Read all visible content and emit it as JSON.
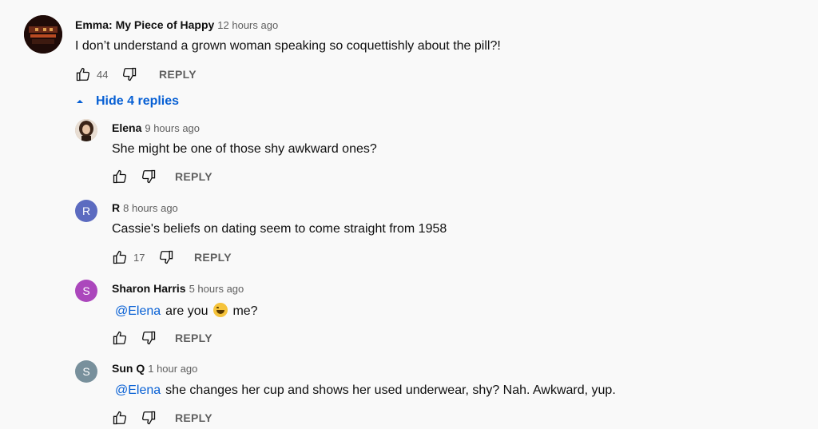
{
  "main_comment": {
    "author": "Emma: My Piece of Happy",
    "time": "12 hours ago",
    "text": "I don’t understand a grown woman speaking so coquettishly about the pill?!",
    "likes": "44",
    "reply_label": "REPLY"
  },
  "hide_replies_label": "Hide 4 replies",
  "replies": [
    {
      "author": "Elena",
      "time": "9 hours ago",
      "mention": "",
      "text": "She might be one of those shy awkward ones?",
      "likes": "",
      "reply_label": "REPLY",
      "avatar_letter": ""
    },
    {
      "author": "R",
      "time": "8 hours ago",
      "mention": "",
      "text": "Cassie's beliefs on dating seem to come straight from 1958",
      "likes": "17",
      "reply_label": "REPLY",
      "avatar_letter": "R",
      "avatar_color": "#5c6bc0"
    },
    {
      "author": "Sharon Harris",
      "time": "5 hours ago",
      "mention": "@Elena",
      "text_before_emoji": "are you",
      "text_after_emoji": "me?",
      "likes": "",
      "reply_label": "REPLY",
      "avatar_letter": "S",
      "avatar_color": "#ab47bc"
    },
    {
      "author": "Sun Q",
      "time": "1 hour ago",
      "mention": "@Elena",
      "text": "she changes her cup and shows her used underwear, shy? Nah. Awkward, yup.",
      "likes": "",
      "reply_label": "REPLY",
      "avatar_letter": "S",
      "avatar_color": "#78909c"
    }
  ]
}
